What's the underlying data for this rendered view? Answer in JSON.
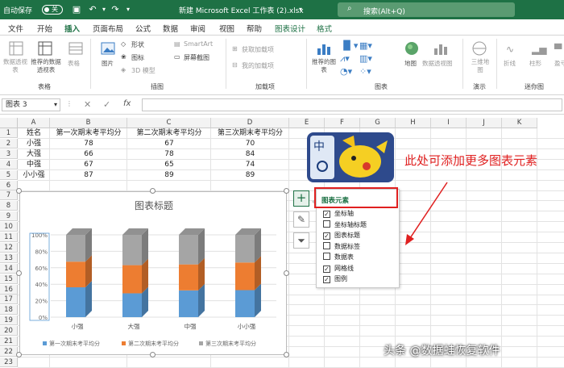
{
  "titlebar": {
    "autosave_label": "自动保存",
    "autosave_state": "关",
    "filename": "新建 Microsoft Excel 工作表 (2).xlsx",
    "search_placeholder": "搜索(Alt+Q)"
  },
  "tabs": [
    "文件",
    "开始",
    "插入",
    "页面布局",
    "公式",
    "数据",
    "审阅",
    "视图",
    "帮助",
    "图表设计",
    "格式"
  ],
  "ribbon": {
    "tables": {
      "pivot": "数据透视表",
      "recommended_pivot": "推荐的数据透视表",
      "table": "表格",
      "label": "表格"
    },
    "illustrations": {
      "pictures": "图片",
      "shapes": "形状",
      "icons": "图标",
      "models": "3D 模型",
      "smartart": "SmartArt",
      "screenshot": "屏幕截图",
      "label": "插图"
    },
    "addins": {
      "get": "获取加载项",
      "my": "我的加载项",
      "label": "加载项"
    },
    "charts": {
      "recommended": "推荐的图表",
      "maps": "地图",
      "pivot_chart": "数据透视图",
      "label": "图表"
    },
    "tours": {
      "map3d": "三维地图",
      "label": "演示"
    },
    "sparklines": {
      "line": "折线",
      "column": "柱形",
      "winloss": "盈亏",
      "label": "迷你图"
    }
  },
  "formula": {
    "namebox": "图表 3",
    "fx": "fx"
  },
  "columns": [
    "A",
    "B",
    "C",
    "D",
    "E",
    "F",
    "G",
    "H",
    "I",
    "J",
    "K"
  ],
  "rows": [
    "1",
    "2",
    "3",
    "4",
    "5",
    "6",
    "7",
    "8",
    "9",
    "10",
    "11",
    "12",
    "13",
    "14",
    "15",
    "16",
    "17",
    "18",
    "19",
    "20",
    "21",
    "22",
    "23"
  ],
  "table": {
    "headers": [
      "姓名",
      "第一次期末考平均分",
      "第二次期末考平均分",
      "第三次期末考平均分"
    ],
    "rows": [
      [
        "小强",
        "78",
        "67",
        "70"
      ],
      [
        "大强",
        "66",
        "78",
        "84"
      ],
      [
        "中强",
        "67",
        "65",
        "74"
      ],
      [
        "小小强",
        "87",
        "89",
        "89"
      ]
    ]
  },
  "chart_data": {
    "type": "bar",
    "stacked": "percent",
    "title": "图表标题",
    "categories": [
      "小强",
      "大强",
      "中强",
      "小小强"
    ],
    "series": [
      {
        "name": "第一次期末考平均分",
        "values": [
          78,
          66,
          67,
          87
        ],
        "color": "#5b9bd5"
      },
      {
        "name": "第二次期末考平均分",
        "values": [
          67,
          78,
          65,
          89
        ],
        "color": "#ed7d31"
      },
      {
        "name": "第三次期末考平均分",
        "values": [
          70,
          84,
          74,
          89
        ],
        "color": "#a5a5a5"
      }
    ],
    "yticks": [
      "0%",
      "20%",
      "40%",
      "60%",
      "80%",
      "100%"
    ],
    "ylim": [
      0,
      100
    ],
    "legend": "bottom",
    "grid": true
  },
  "chart_elements": {
    "title": "图表元素",
    "items": [
      {
        "label": "坐标轴",
        "checked": true
      },
      {
        "label": "坐标轴标题",
        "checked": false
      },
      {
        "label": "图表标题",
        "checked": true
      },
      {
        "label": "数据标签",
        "checked": false
      },
      {
        "label": "数据表",
        "checked": false
      },
      {
        "label": "网格线",
        "checked": true
      },
      {
        "label": "图例",
        "checked": true
      }
    ]
  },
  "annotation": "此处可添加更多图表元素",
  "watermark": "头条 @数据蛙恢复软件",
  "colors": {
    "excel_green": "#1e7145",
    "annotation_red": "#e02020"
  }
}
